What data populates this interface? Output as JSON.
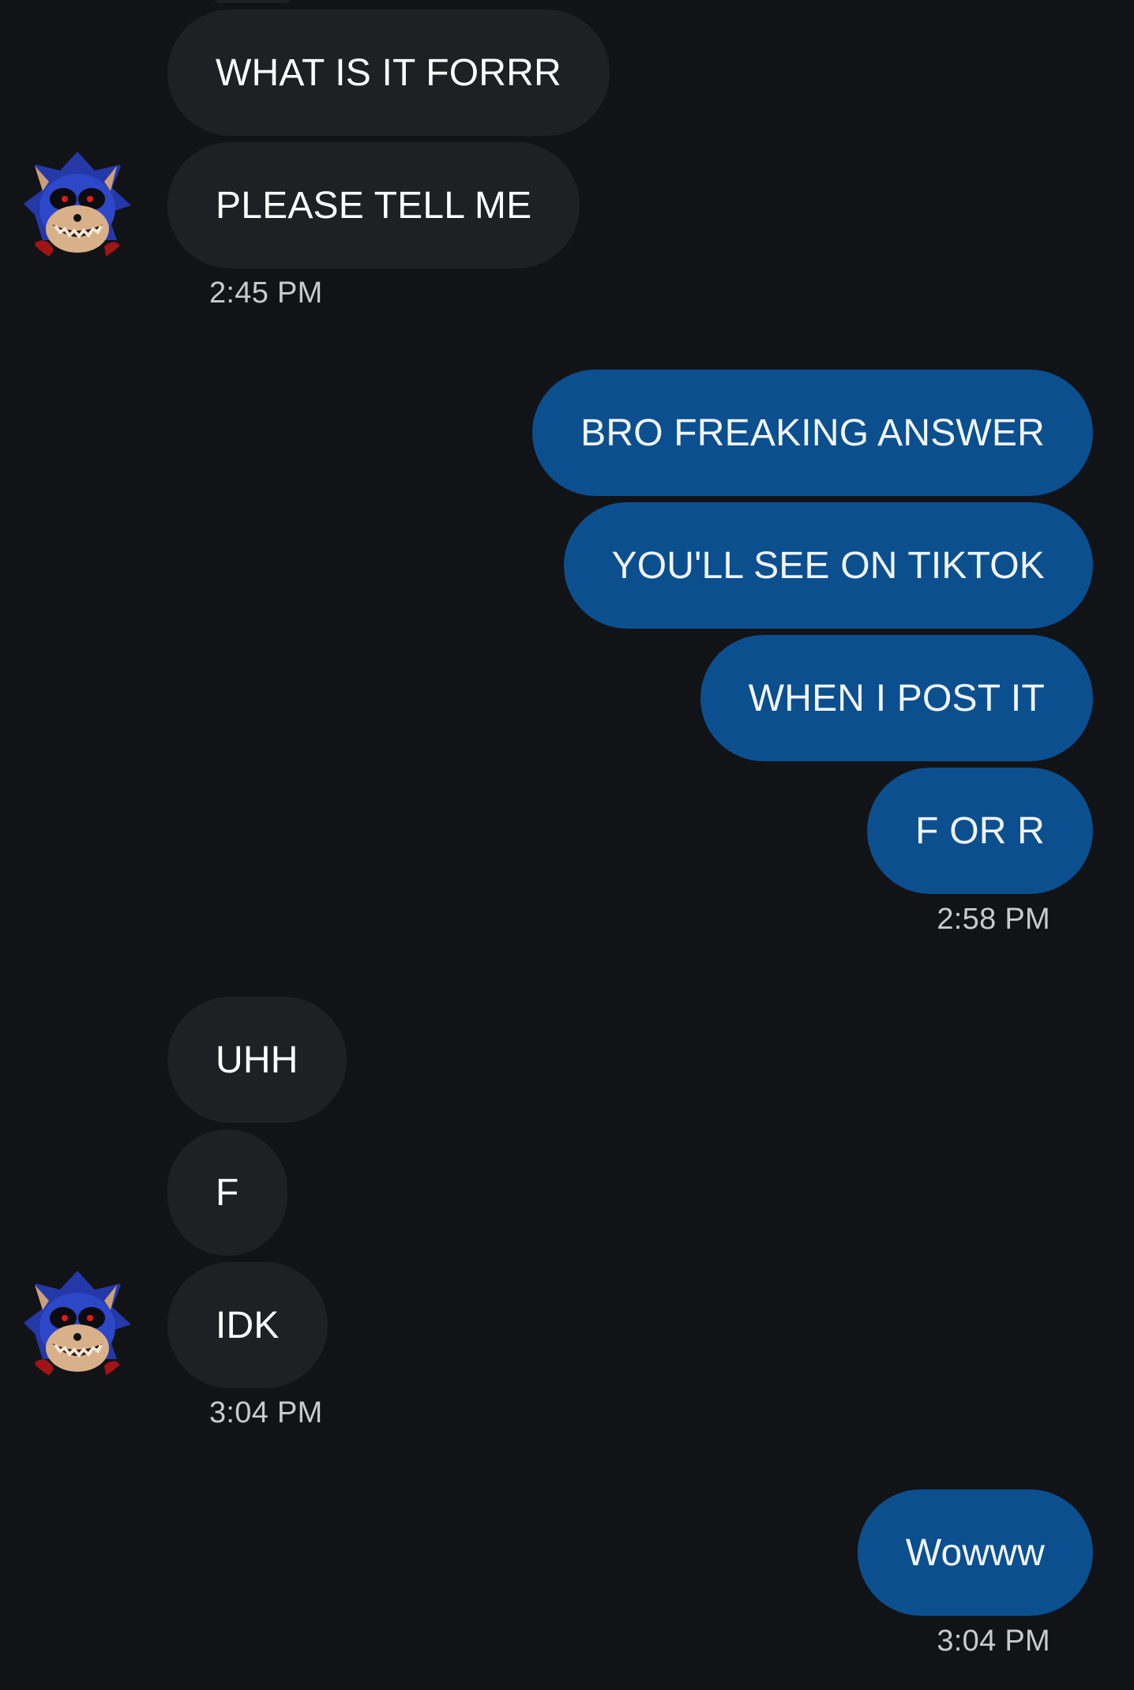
{
  "conversation": {
    "incoming_group_1": {
      "messages": [
        "WHAT IS IT FORRR",
        "PLEASE TELL ME"
      ],
      "timestamp": "2:45 PM",
      "avatar": "evil-hedgehog-avatar"
    },
    "outgoing_group_1": {
      "messages": [
        "BRO FREAKING ANSWER",
        "YOU'LL SEE ON TIKTOK",
        "WHEN I POST IT",
        "F OR R"
      ],
      "timestamp": "2:58 PM"
    },
    "incoming_group_2": {
      "messages": [
        "UHH",
        "F",
        "IDK"
      ],
      "timestamp": "3:04 PM",
      "avatar": "evil-hedgehog-avatar"
    },
    "outgoing_group_2": {
      "messages": [
        "Wowww"
      ],
      "timestamp": "3:04 PM"
    }
  },
  "colors": {
    "background": "#121317",
    "incoming_bubble": "#1f2024",
    "outgoing_bubble": "#0b4f8f",
    "timestamp_text": "#c9cacf"
  }
}
